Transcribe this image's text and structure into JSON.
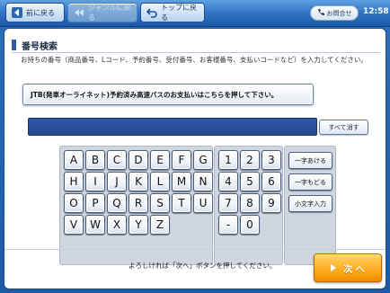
{
  "header": {
    "back_label": "前に戻る",
    "genre_label": "ジャンルに戻る",
    "top_label": "トップに戻る",
    "inquiry_label": "お問合せ",
    "clock": "12:58"
  },
  "main": {
    "title": "番号検索",
    "instruction": "お持ちの番号（商品番号、Lコード、予約番号、受付番号、お客様番号、支払いコードなど）を入力してください。",
    "notice_button": "JTB(発車オーライネット)予約済み高速バスのお支払いはこちらを押して下さい。",
    "input_value": "",
    "clear_label": "すべて消す"
  },
  "keyboard": {
    "letters": [
      "A",
      "B",
      "C",
      "D",
      "E",
      "F",
      "G",
      "H",
      "I",
      "J",
      "K",
      "L",
      "M",
      "N",
      "O",
      "P",
      "Q",
      "R",
      "S",
      "T",
      "U",
      "V",
      "W",
      "X",
      "Y",
      "Z"
    ],
    "numbers": [
      "1",
      "2",
      "3",
      "4",
      "5",
      "6",
      "7",
      "8",
      "9",
      "-",
      "0"
    ],
    "functions": [
      "一字あける",
      "一字もどる",
      "小文字入力"
    ]
  },
  "footer": {
    "message": "よろしければ「次へ」ボタンを押してください。",
    "next_label": "次 へ"
  },
  "colors": {
    "header_blue": "#2d6fc0",
    "input_blue": "#2f57a4",
    "next_orange": "#ffae23"
  }
}
